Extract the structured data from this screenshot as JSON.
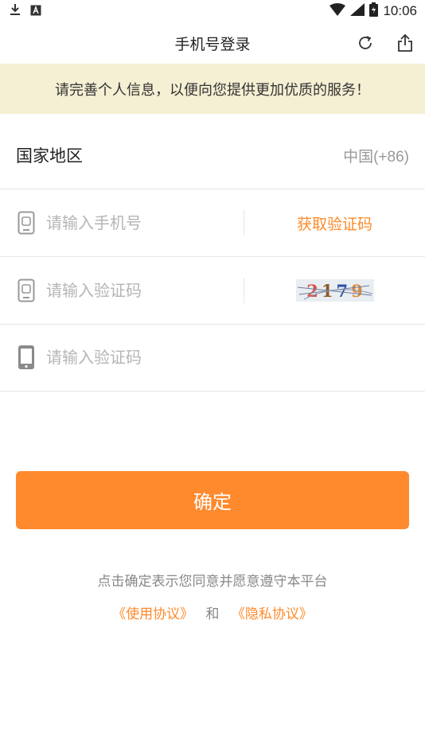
{
  "status_bar": {
    "time": "10:06",
    "icons": [
      "download-icon",
      "a-badge-icon",
      "wifi-icon",
      "signal-icon",
      "battery-icon"
    ]
  },
  "header": {
    "title": "手机号登录",
    "actions": [
      "refresh-icon",
      "share-icon"
    ]
  },
  "notice": {
    "text": "请完善个人信息，以便向您提供更加优质的服务！"
  },
  "country": {
    "label": "国家地区",
    "value": "中国(+86)"
  },
  "phone": {
    "placeholder": "请输入手机号",
    "get_code_label": "获取验证码"
  },
  "captcha_row": {
    "placeholder": "请输入验证码",
    "captcha_digits": [
      "2",
      "1",
      "7",
      "9"
    ],
    "captcha_colors": [
      "#d9534f",
      "#8a5a2b",
      "#2b4fa8",
      "#e08a3c"
    ]
  },
  "sms_row": {
    "placeholder": "请输入验证码"
  },
  "confirm": {
    "label": "确定",
    "color": "#ff8a2e"
  },
  "agreement": {
    "text": "点击确定表示您同意并愿意遵守本平台",
    "user_agreement": "《使用协议》",
    "and": "和",
    "privacy_policy": "《隐私协议》",
    "link_color": "#ff8a2b"
  }
}
